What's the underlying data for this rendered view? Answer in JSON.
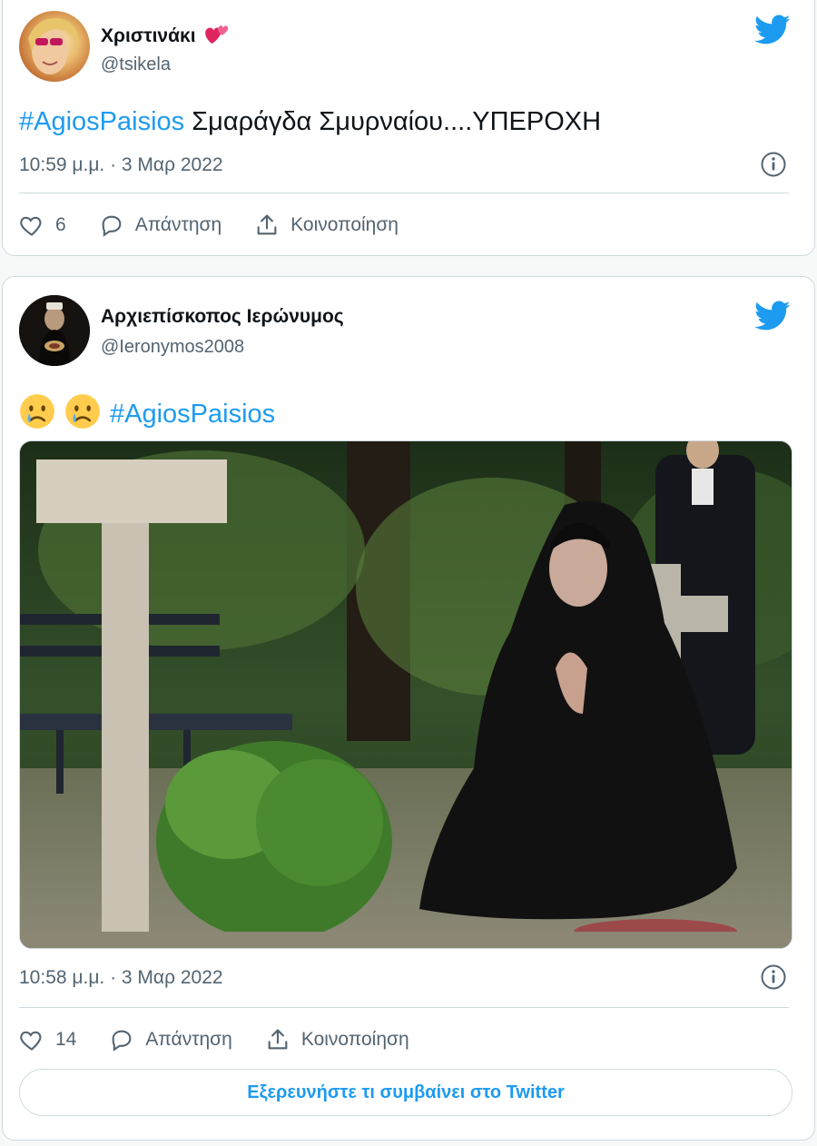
{
  "tweet1": {
    "author_name": "Χριστινάκι",
    "handle": "@tsikela",
    "hashtag": "#AgiosPaisios",
    "text": " Σμαράγδα Σμυρναίου....ΥΠΕΡΟΧΗ",
    "timestamp": "10:59 μ.μ. · 3 Μαρ 2022",
    "likes": "6",
    "reply_label": "Απάντηση",
    "share_label": "Κοινοποίηση",
    "name_emoji": "two-hearts-icon"
  },
  "tweet2": {
    "author_name": "Αρχιεπίσκοπος Ιερώνυμος",
    "handle": "@Ieronymos2008",
    "hashtag": "#AgiosPaisios",
    "emojis": [
      "crying-face-icon",
      "crying-face-icon"
    ],
    "timestamp": "10:58 μ.μ. · 3 Μαρ 2022",
    "likes": "14",
    "reply_label": "Απάντηση",
    "share_label": "Κοινοποίηση",
    "media": "photo"
  },
  "explore_button": "Εξερευνήστε τι συμβαίνει στο Twitter",
  "colors": {
    "accent": "#1d9bf0",
    "text": "#0f1419",
    "muted": "#536471",
    "border": "#cfd9de"
  }
}
